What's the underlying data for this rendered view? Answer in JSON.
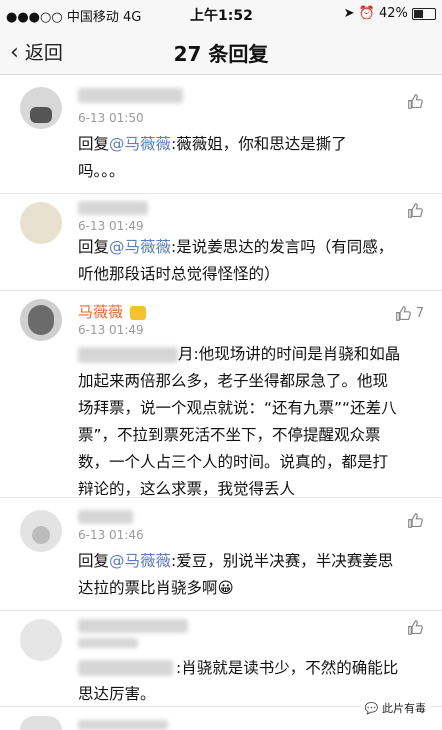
{
  "status_bar": {
    "carrier": "●●●○○ 中国移动  4G",
    "time": "上午1:52",
    "battery": "42%"
  },
  "nav": {
    "back_label": "返回",
    "title": "27 条回复"
  },
  "comments": [
    {
      "date": "6-13 01:50",
      "like_count": "",
      "prefix": "回复",
      "mention": "@马薇薇",
      "body": ":薇薇姐，你和思达是撕了",
      "body2": "吗。。。"
    },
    {
      "date": "6-13 01:49",
      "like_count": "",
      "prefix": "回复",
      "mention": "@马薇薇",
      "body": ":是说姜思达的发言吗（有同感，",
      "body2": "听他那段话时总觉得怪怪的）"
    },
    {
      "name": "马薇薇",
      "date": "6-13 01:49",
      "like_count": "7",
      "body_lines": [
        "月:他现场讲的时间是肖骁和如晶",
        "加起来两倍那么多，老子坐得都尿急了。他现",
        "场拜票，说一个观点就说：“还有九票”“还差八",
        "票”，不拉到票死活不坐下，不停提醒观众票",
        "数，一个人占三个人的时间。说真的，都是打",
        "辩论的，这么求票，我觉得丢人"
      ]
    },
    {
      "date": "6-13 01:46",
      "like_count": "",
      "prefix": "回复",
      "mention": "@马薇薇",
      "body": ":爱豆，别说半决赛，半决赛姜思",
      "body2": "达拉的票比肖骁多啊😀"
    },
    {
      "date": "",
      "like_count": "",
      "body": ":肖骁就是读书少，不然的确能比",
      "body2": "思达厉害。"
    }
  ],
  "watermark": "此片有毒",
  "colors": {
    "mention": "#5c7fb6",
    "name": "#e66a2c",
    "meta": "#9a9a9a"
  }
}
